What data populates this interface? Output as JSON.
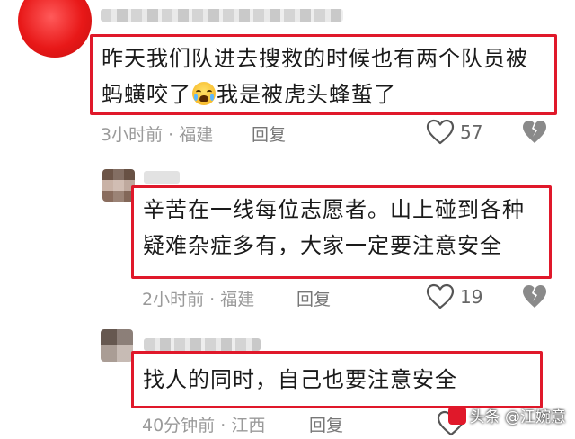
{
  "comments": [
    {
      "text_line1": "昨天我们队进去搜救的时候也有两个队员被",
      "text_line2_before": "蚂蟥咬了",
      "text_line2_after": "我是被虎头蜂蜇了",
      "emoji": "crying-face",
      "time": "3小时前",
      "location": "福建",
      "reply_label": "回复",
      "likes": "57"
    },
    {
      "text_line1": "辛苦在一线每位志愿者。山上碰到各种",
      "text_line2": "疑难杂症多有，大家一定要注意安全",
      "time": "2小时前",
      "location": "福建",
      "reply_label": "回复",
      "likes": "19"
    },
    {
      "text_line1": "找人的同时，自己也要注意安全",
      "time": "40分钟前",
      "location": "江西",
      "reply_label": "回复"
    }
  ],
  "separator": " · ",
  "watermark": "头条 @江婉意",
  "colors": {
    "highlight_border": "#e0182a",
    "meta": "#9a9a9a"
  }
}
